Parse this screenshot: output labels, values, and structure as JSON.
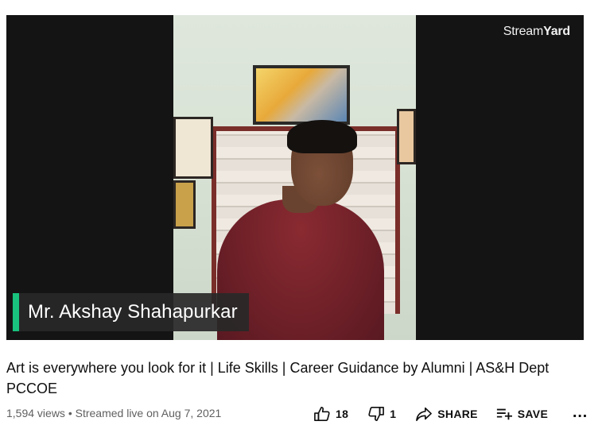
{
  "video": {
    "brand_watermark_a": "Stream",
    "brand_watermark_b": "Yard",
    "lower_third_name": "Mr. Akshay Shahapurkar",
    "accent_color": "#19c37d"
  },
  "details": {
    "title": "Art is everywhere you look for it | Life Skills | Career Guidance by Alumni | AS&H Dept PCCOE",
    "views": "1,594 views",
    "separator": "•",
    "streamed": "Streamed live on Aug 7, 2021"
  },
  "actions": {
    "like_count": "18",
    "dislike_count": "1",
    "share_label": "SHARE",
    "save_label": "SAVE",
    "more_label": "…",
    "icons": [
      "thumbs-up-icon",
      "thumbs-down-icon",
      "share-icon",
      "playlist-add-icon",
      "more-icon"
    ]
  }
}
